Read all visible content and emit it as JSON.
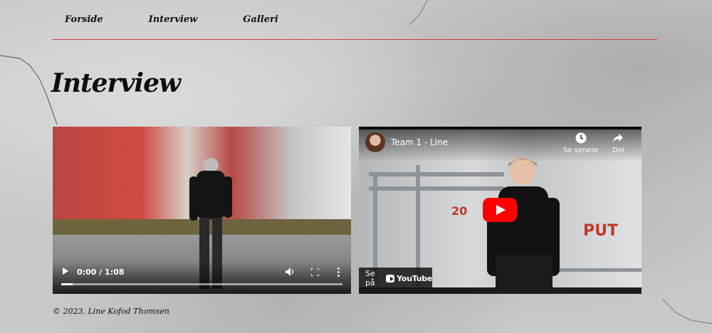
{
  "nav": {
    "items": [
      {
        "label": "Forside"
      },
      {
        "label": "Interview"
      },
      {
        "label": "Galleri"
      }
    ],
    "divider_color": "#d43a3a"
  },
  "page": {
    "title": "Interview"
  },
  "video_left": {
    "current_time": "0:00 / 1:08",
    "progress_fraction": 0.0,
    "controls": [
      "play-icon",
      "volume-icon",
      "fullscreen-icon",
      "more-options-icon"
    ]
  },
  "video_right": {
    "channel_title": "Team 1 - Line",
    "watch_later_label": "Se senere",
    "share_label": "Del",
    "watch_on_label": "Se på",
    "brand_label": "YouTube",
    "play_button_color": "#ff0000"
  },
  "footer": {
    "text": "© 2023, Line Kofod Thomsen"
  }
}
